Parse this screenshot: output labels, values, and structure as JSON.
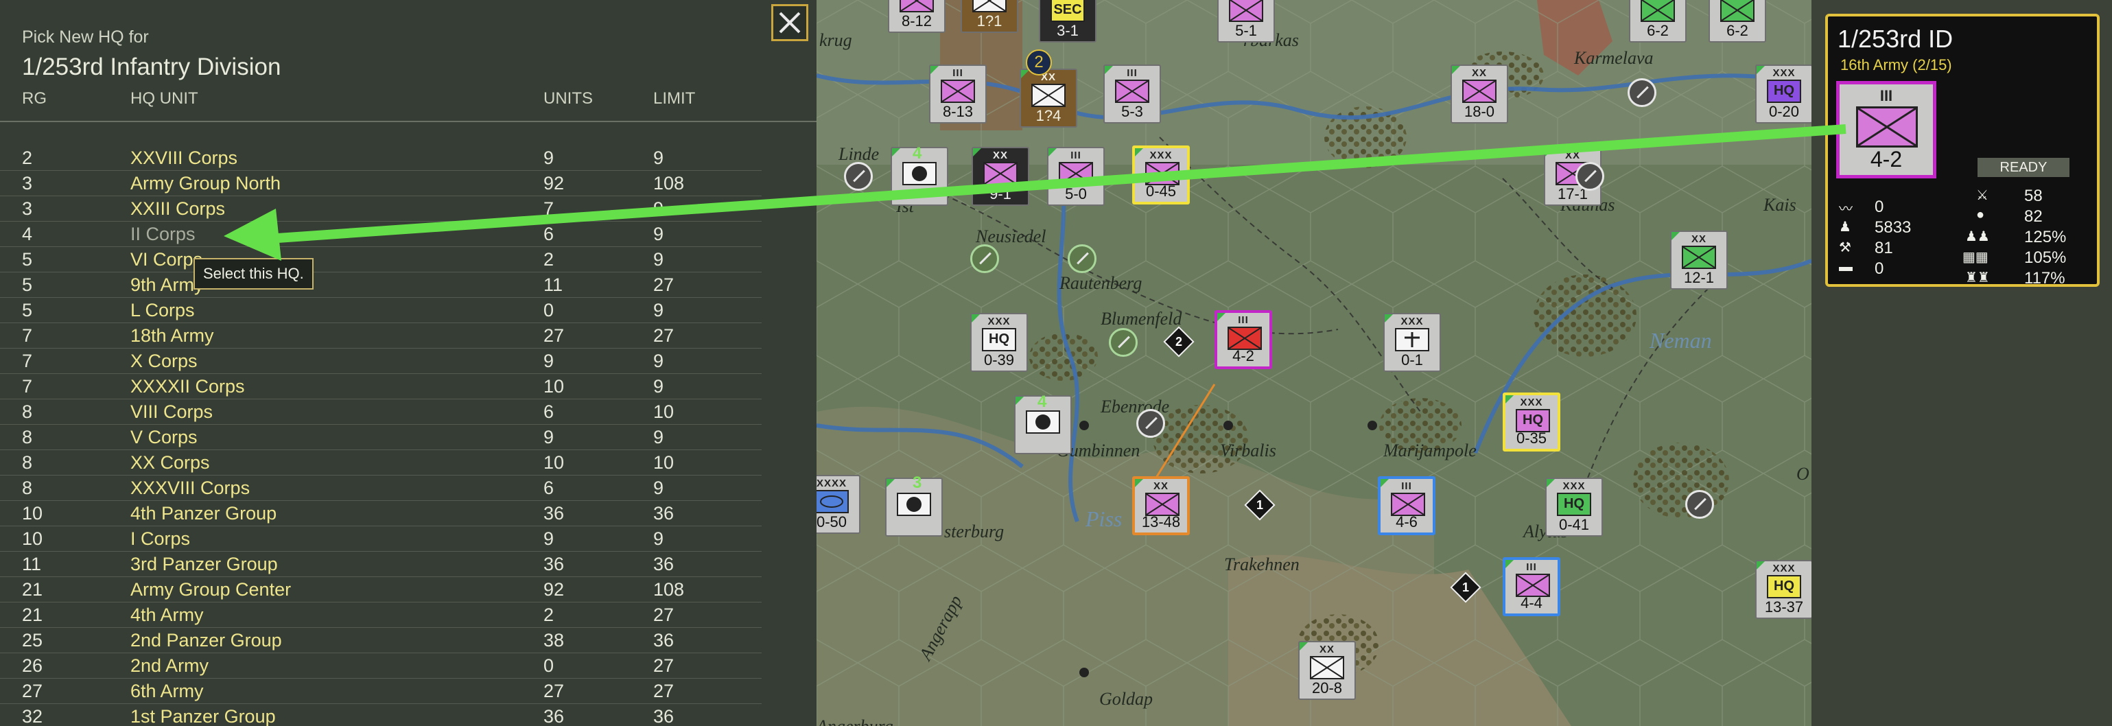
{
  "panel": {
    "pretitle": "Pick New HQ for",
    "title": "1/253rd Infantry Division",
    "columns": {
      "rg": "RG",
      "hq": "HQ UNIT",
      "units": "UNITS",
      "limit": "LIMIT"
    },
    "tooltip": "Select this HQ.",
    "rows": [
      {
        "rg": "2",
        "name": "XXVIII Corps",
        "units": "9",
        "limit": "9"
      },
      {
        "rg": "3",
        "name": "Army Group North",
        "units": "92",
        "limit": "108"
      },
      {
        "rg": "3",
        "name": "XXIII Corps",
        "units": "7",
        "limit": "9"
      },
      {
        "rg": "4",
        "name": "II Corps",
        "units": "6",
        "limit": "9"
      },
      {
        "rg": "5",
        "name": "VI Corps",
        "units": "2",
        "limit": "9"
      },
      {
        "rg": "5",
        "name": "9th Army",
        "units": "11",
        "limit": "27"
      },
      {
        "rg": "5",
        "name": "L Corps",
        "units": "0",
        "limit": "9"
      },
      {
        "rg": "7",
        "name": "18th Army",
        "units": "27",
        "limit": "27"
      },
      {
        "rg": "7",
        "name": "X Corps",
        "units": "9",
        "limit": "9"
      },
      {
        "rg": "7",
        "name": "XXXXII Corps",
        "units": "10",
        "limit": "9"
      },
      {
        "rg": "8",
        "name": "VIII Corps",
        "units": "6",
        "limit": "10"
      },
      {
        "rg": "8",
        "name": "V Corps",
        "units": "9",
        "limit": "9"
      },
      {
        "rg": "8",
        "name": "XX Corps",
        "units": "10",
        "limit": "10"
      },
      {
        "rg": "8",
        "name": "XXXVIII Corps",
        "units": "6",
        "limit": "9"
      },
      {
        "rg": "10",
        "name": "4th Panzer Group",
        "units": "36",
        "limit": "36"
      },
      {
        "rg": "10",
        "name": "I Corps",
        "units": "9",
        "limit": "9"
      },
      {
        "rg": "11",
        "name": "3rd Panzer Group",
        "units": "36",
        "limit": "36"
      },
      {
        "rg": "21",
        "name": "Army Group Center",
        "units": "92",
        "limit": "108"
      },
      {
        "rg": "21",
        "name": "4th Army",
        "units": "2",
        "limit": "27"
      },
      {
        "rg": "25",
        "name": "2nd Panzer Group",
        "units": "38",
        "limit": "36"
      },
      {
        "rg": "26",
        "name": "2nd Army",
        "units": "0",
        "limit": "27"
      },
      {
        "rg": "27",
        "name": "6th Army",
        "units": "27",
        "limit": "27"
      },
      {
        "rg": "32",
        "name": "1st Panzer Group",
        "units": "36",
        "limit": "36"
      }
    ]
  },
  "map": {
    "places": [
      {
        "name": "rbarkas"
      },
      {
        "name": "Karmelava"
      },
      {
        "name": "Kaunas"
      },
      {
        "name": "Kais"
      },
      {
        "name": "Linde"
      },
      {
        "name": "Neusiedel"
      },
      {
        "name": "Rautenberg"
      },
      {
        "name": "Blumenfeld"
      },
      {
        "name": "Ebenrode"
      },
      {
        "name": "Gumbinnen"
      },
      {
        "name": "Virbalis"
      },
      {
        "name": "Marijampole"
      },
      {
        "name": "Neman"
      },
      {
        "name": "sterburg"
      },
      {
        "name": "Piss"
      },
      {
        "name": "Trakehnen"
      },
      {
        "name": "Alytus"
      },
      {
        "name": "Angerapp"
      },
      {
        "name": "Goldap"
      },
      {
        "name": "Angerburg"
      },
      {
        "name": "krug"
      },
      {
        "name": "Ist"
      },
      {
        "name": "O"
      }
    ],
    "counters": [
      {
        "size": "",
        "str": "8-12",
        "sym": "pink"
      },
      {
        "size": "",
        "str": "1?1",
        "sym": "white"
      },
      {
        "size": "SEC",
        "str": "3-1",
        "sym": "yellow"
      },
      {
        "size": "",
        "str": "5-1",
        "sym": "pink"
      },
      {
        "size": "",
        "str": "6-2",
        "sym": "green"
      },
      {
        "size": "",
        "str": "6-2",
        "sym": "green"
      },
      {
        "size": "III",
        "str": "8-13",
        "sym": "pink"
      },
      {
        "size": "XX",
        "str": "1?4",
        "sym": "white"
      },
      {
        "size": "III",
        "str": "5-3",
        "sym": "pink"
      },
      {
        "size": "XX",
        "str": "18-0",
        "sym": "pink"
      },
      {
        "size": "XXX",
        "str": "0-20",
        "sym": "hq-purple",
        "hq": "HQ"
      },
      {
        "size": "XX",
        "str": "9-1",
        "sym": "pink"
      },
      {
        "size": "III",
        "str": "5-0",
        "sym": "pink"
      },
      {
        "size": "XXX",
        "str": "0-45",
        "sym": "pink"
      },
      {
        "size": "XX",
        "str": "17-1",
        "sym": "pink"
      },
      {
        "size": "XX",
        "str": "12-1",
        "sym": "green"
      },
      {
        "size": "XXX",
        "str": "0-39",
        "sym": "hq-white",
        "hq": "HQ"
      },
      {
        "size": "III",
        "str": "4-2",
        "sym": "red"
      },
      {
        "size": "XXX",
        "str": "0-1",
        "sym": "white"
      },
      {
        "size": "XXX",
        "str": "0-35",
        "sym": "hq-pink",
        "hq": "HQ"
      },
      {
        "size": "XXXX",
        "str": "0-50",
        "sym": "blue"
      },
      {
        "size": "XX",
        "str": "13-48",
        "sym": "pink"
      },
      {
        "size": "III",
        "str": "4-6",
        "sym": "pink"
      },
      {
        "size": "XXX",
        "str": "0-41",
        "sym": "hq-green",
        "hq": "HQ"
      },
      {
        "size": "III",
        "str": "4-4",
        "sym": "pink"
      },
      {
        "size": "XXX",
        "str": "13-37",
        "sym": "hq-yellow",
        "hq": "HQ"
      },
      {
        "size": "XX",
        "str": "20-8",
        "sym": "white"
      }
    ],
    "stack_badges": [
      "4",
      "4",
      "3",
      "2"
    ],
    "markers": [
      "2",
      "1",
      "1"
    ]
  },
  "unit": {
    "title": "1/253rd ID",
    "subtitle": "16th Army (2/15)",
    "size": "III",
    "strength": "4-2",
    "status": "READY",
    "stats_left": [
      "0",
      "5833",
      "81",
      "0"
    ],
    "stats_right_values": [
      "58",
      "82",
      "125%",
      "105%",
      "117%"
    ]
  },
  "colors": {
    "accent": "#e2c23c",
    "selected": "#c226c7",
    "arrow": "#66e04a",
    "hq_name": "#eee58c"
  }
}
